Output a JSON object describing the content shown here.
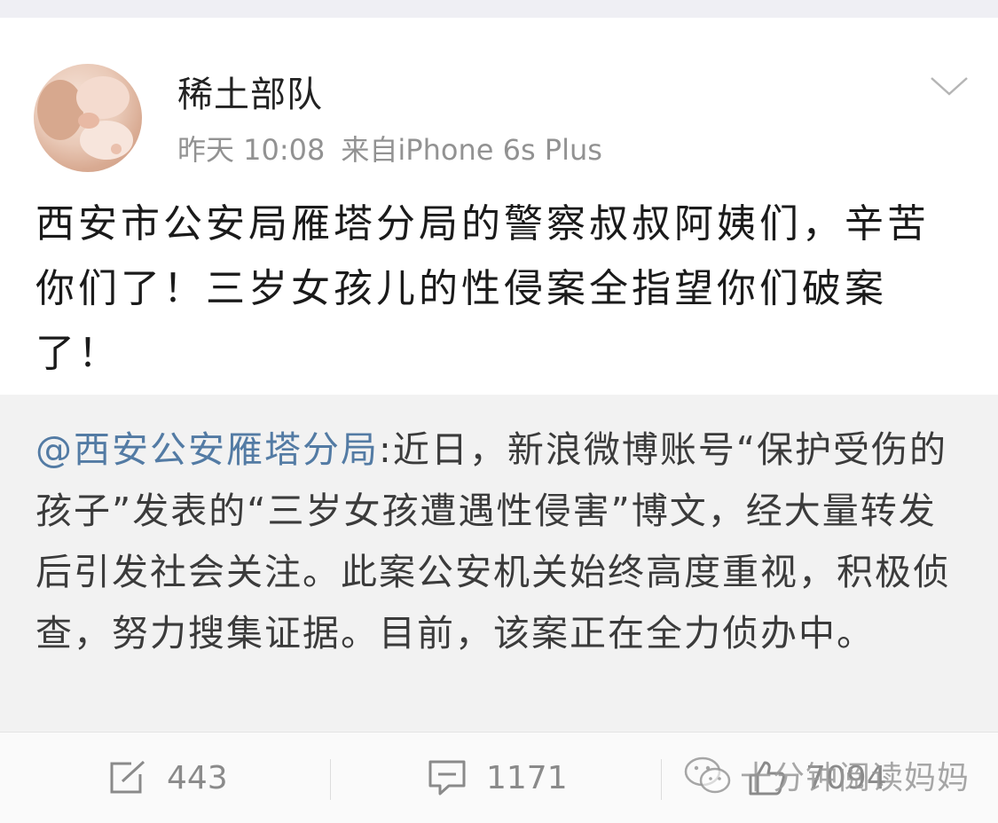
{
  "post": {
    "author": "稀土部队",
    "time": "昨天 10:08",
    "source": "来自iPhone 6s Plus",
    "text": "西安市公安局雁塔分局的警察叔叔阿姨们，辛苦你们了！三岁女孩儿的性侵案全指望你们破案了！"
  },
  "retweet": {
    "mention": "@西安公安雁塔分局",
    "text": ":近日，新浪微博账号“保护受伤的孩子”发表的“三岁女孩遭遇性侵害”博文，经大量转发后引发社会关注。此案公安机关始终高度重视，积极侦查，努力搜集证据。目前，该案正在全力侦办中。"
  },
  "actions": {
    "repost_icon": "repost-icon",
    "repost_count": "443",
    "comment_icon": "comment-icon",
    "comment_count": "1171",
    "like_icon": "thumbs-up-icon",
    "like_count": "7094"
  },
  "watermark": {
    "text": "十分钟阅读妈妈"
  },
  "colors": {
    "mention": "#537ba4",
    "meta": "#929292",
    "retweet_bg": "#f2f2f2"
  }
}
